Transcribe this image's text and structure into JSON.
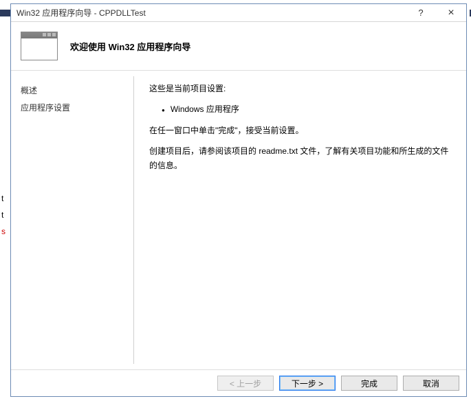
{
  "titlebar": {
    "title": "Win32 应用程序向导 - CPPDLLTest",
    "help_symbol": "?",
    "close_symbol": "×"
  },
  "header": {
    "title": "欢迎使用 Win32 应用程序向导"
  },
  "sidebar": {
    "items": [
      {
        "label": "概述"
      },
      {
        "label": "应用程序设置"
      }
    ]
  },
  "content": {
    "intro": "这些是当前项目设置:",
    "bullet": "Windows 应用程序",
    "line2": "在任一窗口中单击\"完成\"，接受当前设置。",
    "line3": "创建项目后，请参阅该项目的 readme.txt 文件，了解有关项目功能和所生成的文件的信息。"
  },
  "footer": {
    "prev": "< 上一步",
    "next": "下一步 >",
    "finish": "完成",
    "cancel": "取消"
  },
  "bg_letters": {
    "t1": "t",
    "t2": "t",
    "s": "s"
  }
}
